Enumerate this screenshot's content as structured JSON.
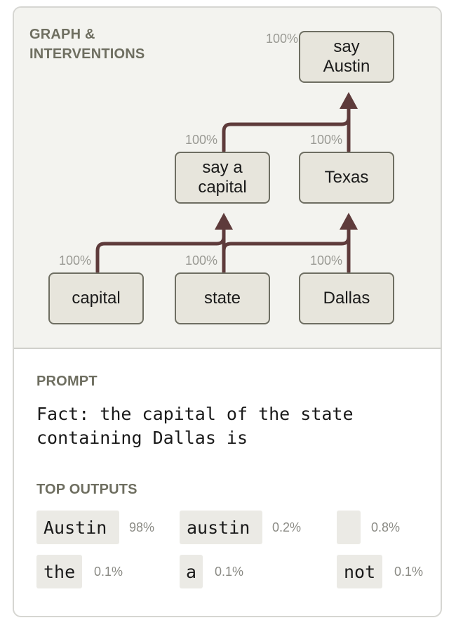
{
  "graph": {
    "title": "GRAPH &\nINTERVENTIONS",
    "nodes": {
      "say_austin": {
        "label": "say\nAustin",
        "pct": "100%"
      },
      "say_a_capital": {
        "label": "say a\ncapital",
        "pct": "100%"
      },
      "texas": {
        "label": "Texas",
        "pct": "100%"
      },
      "capital": {
        "label": "capital",
        "pct": "100%"
      },
      "state": {
        "label": "state",
        "pct": "100%"
      },
      "dallas": {
        "label": "Dallas",
        "pct": "100%"
      }
    },
    "colors": {
      "edge": "#5e3b3b",
      "node_fill": "#e7e5dc",
      "node_border": "#6e6e62",
      "panel_bg": "#f3f3ef"
    }
  },
  "prompt": {
    "title": "PROMPT",
    "text": "Fact: the capital of the state\ncontaining Dallas is"
  },
  "top_outputs": {
    "title": "TOP OUTPUTS",
    "items": [
      {
        "token": "Austin",
        "prob": "98%"
      },
      {
        "token": "austin",
        "prob": "0.2%"
      },
      {
        "token": "",
        "prob": "0.8%"
      },
      {
        "token": "the",
        "prob": "0.1%"
      },
      {
        "token": "a",
        "prob": "0.1%"
      },
      {
        "token": "not",
        "prob": "0.1%"
      }
    ]
  }
}
